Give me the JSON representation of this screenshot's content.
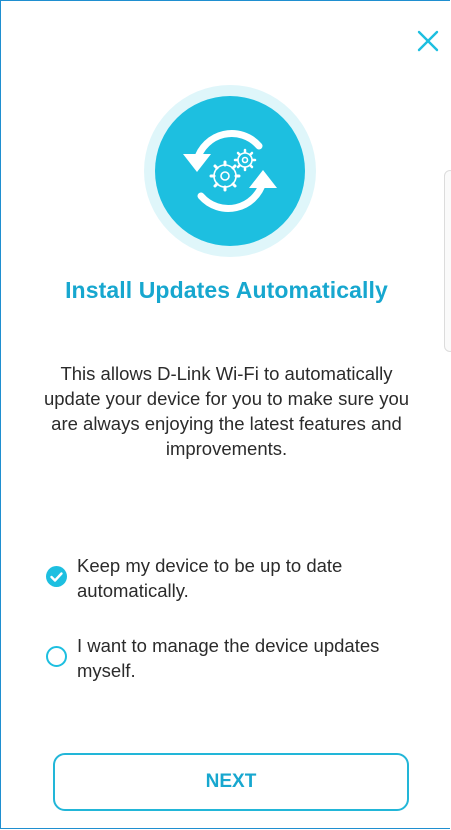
{
  "dialog": {
    "title": "Install Updates Automatically",
    "description": "This allows D-Link Wi-Fi to automatically update your device for you to make sure you are always enjoying the latest features and improvements."
  },
  "options": [
    {
      "label": "Keep my device to be up to date automatically.",
      "selected": true
    },
    {
      "label": "I want to manage the device updates myself.",
      "selected": false
    }
  ],
  "buttons": {
    "next_label": "NEXT"
  },
  "icons": {
    "close": "close-icon",
    "hero": "auto-update-gears-icon",
    "check": "check-icon"
  },
  "colors": {
    "accent": "#1dbfe0",
    "title": "#17a7cf",
    "hero_ring": "#dff6fa",
    "border": "#1f8fd0",
    "text": "#2b2b2b"
  }
}
